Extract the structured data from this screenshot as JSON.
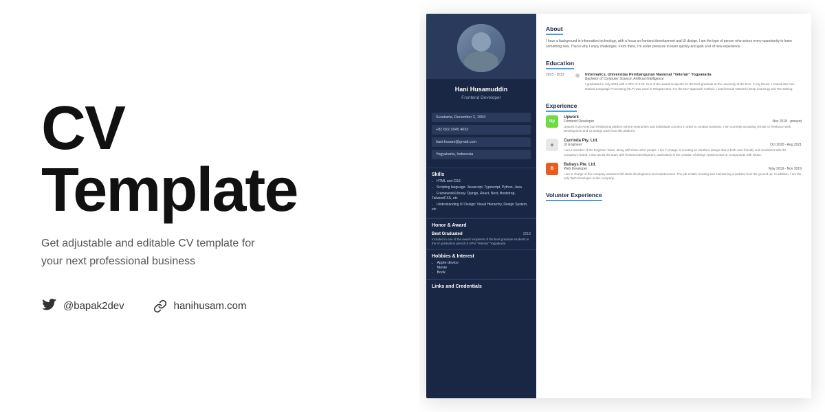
{
  "left": {
    "title_line1": "CV",
    "title_line2": "Template",
    "subtitle": "Get adjustable and editable CV template for your next professional business",
    "social": {
      "twitter": "@bapak2dev",
      "website": "hanihusam.com"
    }
  },
  "cv": {
    "person": {
      "name": "Hani Husamuddin",
      "role": "Frontend Developer"
    },
    "fields": [
      "Surakarta, December 2, 1994",
      "+82 822 2045 4652",
      "hani.husam@gmail.com",
      "Yogyakarta, Indonesia"
    ],
    "sections": {
      "about": {
        "title": "About",
        "text": "I have a background in information technology, with a focus on frontend development and UI design. I am the type of person who seizes every opportunity to learn something new. That is why I enjoy challenges. From there, I'm under pressure to learn quickly and gain a lot of new experience."
      },
      "education": {
        "title": "Education",
        "items": [
          {
            "years": "2015 - 2019",
            "school": "Informatics, Universitas Pembangunan Nasional \"Veteran\" Yogyakarta",
            "degree": "Bachelor of Computer Science, Artificial Intelligence",
            "desc": "I graduated in July 2019 with a GPA of 3.63. One of the award recipients for the best graduate at the university at the time. In my thesis, I looked into how Natural Language Processing (NLP) was used in Telegram Bot. For the NLP approach method, I used Neural Network (Deep Learning) and Text Mining."
          }
        ]
      },
      "experience": {
        "title": "Experience",
        "items": [
          {
            "company": "Upwork",
            "logo_text": "Up",
            "logo_class": "logo-upwork",
            "role": "Frontend Developer",
            "period": "Nov 2018 - present",
            "desc": "Upwork is an American freelancing platform where enterprises and individuals connect in order to conduct business. I am currently accepting remote or freelance Web Development and UI Design work from this platform."
          },
          {
            "company": "Currinda Pty. Ltd.",
            "logo_text": "✦",
            "logo_class": "logo-currinda",
            "role": "UI Engineer",
            "period": "Oct 2020 - Aug 2021",
            "desc": "I am a member of the Engineer Team, along with three other people. I am in charge of creating an interface design that is both user-friendly and consistent with the company's brand. I also assist the team with frontend development, particularly in the creation of design systems and UI components with React."
          },
          {
            "company": "Bubays Pte. Ltd.",
            "logo_text": "B",
            "logo_class": "logo-bubays",
            "role": "Web Developer",
            "period": "May 2019 - Nov 2019",
            "desc": "I am in charge of the company website's full-stack development and maintenance. The job entails creating and maintaining a website from the ground up. In addition, I am the only Web Developer in this company."
          }
        ]
      },
      "skills": {
        "title": "Skills",
        "items": [
          "HTML and CSS",
          "Scripting language: Javascript, Typescript, Python, Java",
          "Framework/Library: Django, React, Next, Bootstrap, TailwindCSS, etc",
          "Understanding UI Design: Visual Hierarchy, Design System, etc"
        ]
      },
      "award": {
        "title": "Honor & Award",
        "name": "Best Graduated",
        "year": "2019",
        "desc": "Included in one of the award recipients of the best graduate students in the IV graduation period of UPN \"Veteran\" Yogyakarta"
      },
      "hobbies": {
        "title": "Hobbies & Interest",
        "items": [
          "Apple device",
          "Movie",
          "Book"
        ]
      },
      "links": {
        "title": "Links and Credentials"
      },
      "volunteer": {
        "title": "Volunter Experience"
      }
    }
  }
}
